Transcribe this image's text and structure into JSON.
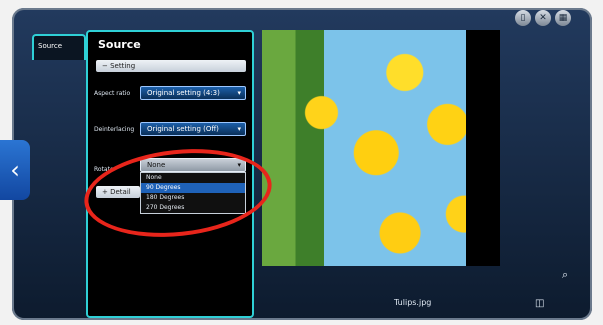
{
  "window": {
    "top_icons": [
      {
        "icon": "document-icon",
        "glyph": "▯"
      },
      {
        "icon": "close-icon",
        "glyph": "✕"
      },
      {
        "icon": "grid-icon",
        "glyph": "▦"
      }
    ],
    "left_nav_glyph": "‹",
    "zoom_glyph": "⌕",
    "tray_glyph": "◫"
  },
  "sidebar": {
    "tab_label": "Source"
  },
  "panel": {
    "title": "Source",
    "section_label": "Setting",
    "section_toggle": "−",
    "aspect_ratio": {
      "label": "Aspect ratio",
      "value": "Original setting (4:3)"
    },
    "deinterlacing": {
      "label": "Deinterlacing",
      "value": "Original setting (Off)"
    },
    "rotate": {
      "label": "Rotate",
      "value": "None"
    },
    "rotate_options": [
      "None",
      "90 Degrees",
      "180 Degrees",
      "270 Degrees"
    ],
    "rotate_selected_index": 1,
    "collapsed_section_label": "Detail",
    "collapsed_section_toggle": "+"
  },
  "preview": {
    "filename": "Tulips.jpg"
  },
  "annotation": {
    "highlight_color": "#e8251b"
  }
}
